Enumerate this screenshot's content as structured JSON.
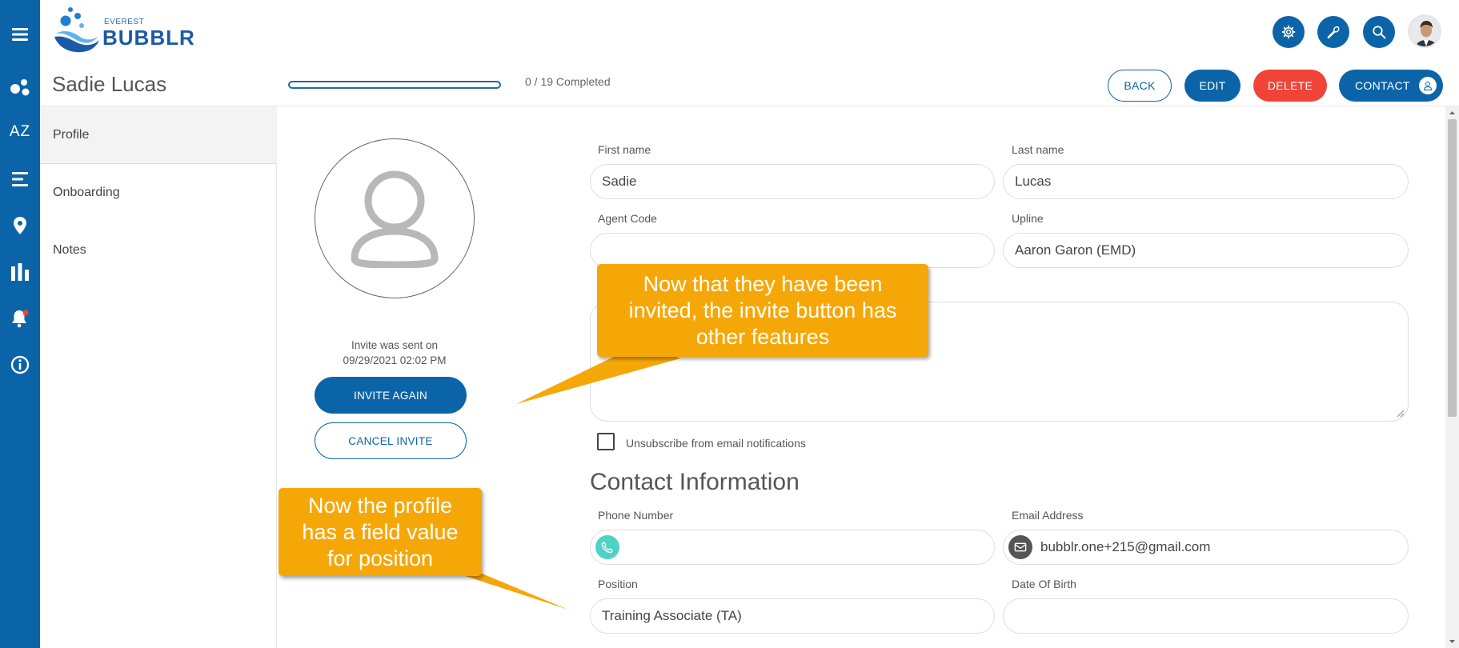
{
  "brand": {
    "top": "EVEREST",
    "name": "BUBBLR"
  },
  "rail": {
    "az_label": "AZ"
  },
  "header": {
    "title": "Sadie Lucas",
    "progress_text": "0 / 19 Completed",
    "progress": 0
  },
  "buttons": {
    "back": "BACK",
    "edit": "EDIT",
    "delete": "DELETE",
    "contact": "CONTACT"
  },
  "sidebar": {
    "items": [
      {
        "label": "Profile"
      },
      {
        "label": "Onboarding"
      },
      {
        "label": "Notes"
      }
    ]
  },
  "invite": {
    "line1": "Invite was sent on",
    "line2": "09/29/2021 02:02 PM",
    "again_label": "INVITE AGAIN",
    "cancel_label": "CANCEL INVITE"
  },
  "form": {
    "first_name": {
      "label": "First name",
      "value": "Sadie"
    },
    "last_name": {
      "label": "Last name",
      "value": "Lucas"
    },
    "agent_code": {
      "label": "Agent Code",
      "value": ""
    },
    "upline": {
      "label": "Upline",
      "value": "Aaron Garon (EMD)"
    },
    "unsubscribe_label": "Unsubscribe from email notifications",
    "contact_heading": "Contact Information",
    "phone": {
      "label": "Phone Number",
      "value": ""
    },
    "email": {
      "label": "Email Address",
      "value": "bubblr.one+215@gmail.com"
    },
    "position": {
      "label": "Position",
      "value": "Training Associate (TA)"
    },
    "dob": {
      "label": "Date Of Birth",
      "value": ""
    }
  },
  "callouts": {
    "invite": "Now that they have been invited, the invite button has other features",
    "position": "Now the profile has a field value for position"
  },
  "colors": {
    "primary": "#0c64a8",
    "danger": "#f04438",
    "callout": "#f6a708",
    "phone_icon": "#4fd1c5",
    "email_icon": "#555555"
  }
}
